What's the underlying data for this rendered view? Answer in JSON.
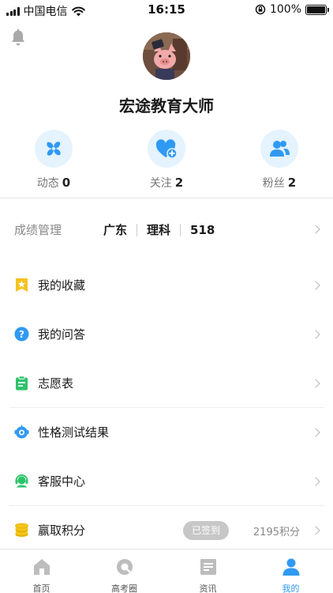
{
  "status_bar": {
    "carrier": "中国电信",
    "time": "16:15",
    "battery": "100%"
  },
  "profile": {
    "username": "宏途教育大师"
  },
  "stats": [
    {
      "label": "动态",
      "count": "0",
      "icon": "pinwheel-icon"
    },
    {
      "label": "关注",
      "count": "2",
      "icon": "heart-plus-icon"
    },
    {
      "label": "粉丝",
      "count": "2",
      "icon": "users-icon"
    }
  ],
  "score": {
    "title": "成绩管理",
    "province": "广东",
    "subject": "理科",
    "score": "518"
  },
  "menu": [
    {
      "label": "我的收藏",
      "icon": "favorites-bookmark-icon"
    },
    {
      "label": "我的问答",
      "icon": "question-icon"
    },
    {
      "label": "志愿表",
      "icon": "clipboard-icon"
    },
    {
      "label": "性格测试结果",
      "icon": "robot-face-icon"
    },
    {
      "label": "客服中心",
      "icon": "headset-icon"
    },
    {
      "label": "赢取积分",
      "icon": "coins-icon"
    }
  ],
  "points": {
    "signed_label": "已签到",
    "value": "2195积分"
  },
  "tabbar": [
    {
      "label": "首页",
      "icon": "home-icon"
    },
    {
      "label": "高考圈",
      "icon": "circle-icon"
    },
    {
      "label": "资讯",
      "icon": "news-icon"
    },
    {
      "label": "我的",
      "icon": "profile-icon",
      "active": true
    }
  ],
  "colors": {
    "accent": "#2f9af3",
    "icon_bg": "#e4f3fe",
    "star_yellow": "#f6c320",
    "green": "#2ec36b",
    "coin_yellow": "#f5c518"
  }
}
